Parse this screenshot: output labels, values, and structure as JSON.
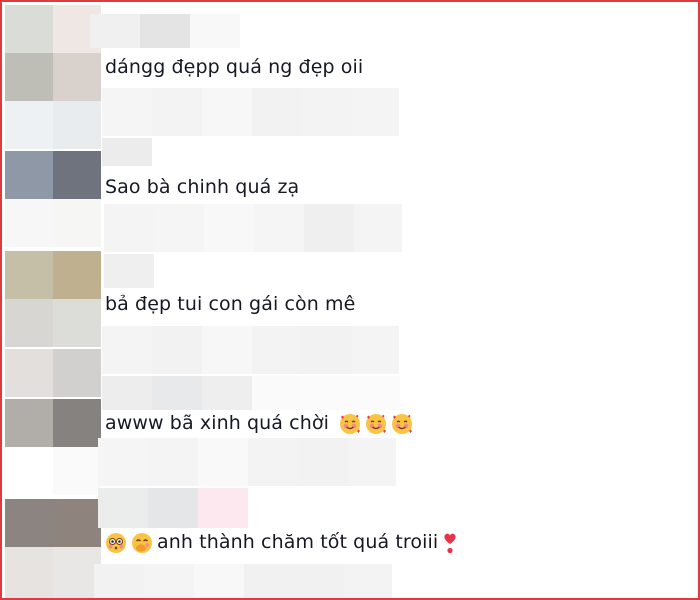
{
  "comments": [
    {
      "text": "dángg đẹpp quá ng đẹp oii"
    },
    {
      "text": "Sao bà chinh quá zạ"
    },
    {
      "text": "bả đẹp tui con gái còn mê"
    },
    {
      "text": "awww bã xinh quá chời",
      "emojis": [
        "smiling-face-with-hearts",
        "smiling-face-with-hearts",
        "smiling-face-with-hearts"
      ]
    },
    {
      "text": "anh thành chăm tốt quá troiii",
      "lead_emojis": [
        "flushed-face",
        "face-with-hand-over-mouth"
      ],
      "trail_emoji": "heart-exclamation"
    }
  ],
  "colors": {
    "border": "#e03a3e",
    "text": "#161823"
  }
}
